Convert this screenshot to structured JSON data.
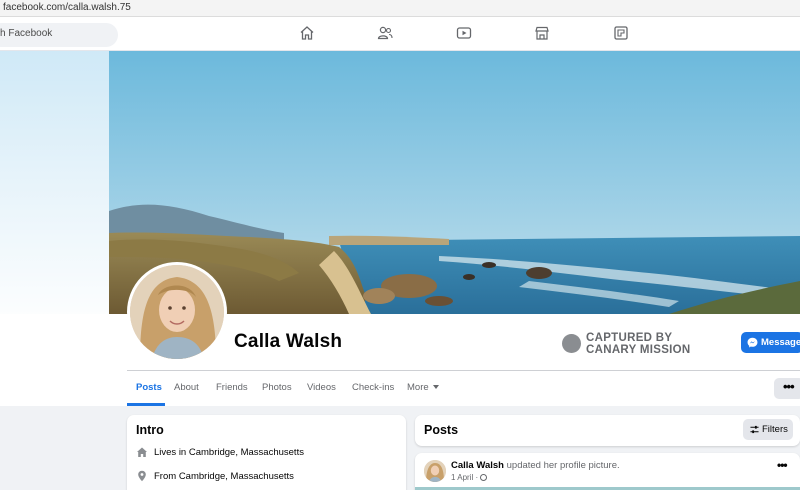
{
  "browser": {
    "url": "facebook.com/calla.walsh.75"
  },
  "topnav": {
    "search_placeholder": "h Facebook",
    "icons": [
      "home-icon",
      "friends-icon",
      "watch-icon",
      "marketplace-icon",
      "gaming-icon"
    ]
  },
  "profile": {
    "name": "Calla Walsh",
    "watermark_line1": "CAPTURED BY",
    "watermark_line2": "CANARY MISSION",
    "message_label": "Message"
  },
  "tabs": [
    {
      "label": "Posts",
      "active": true
    },
    {
      "label": "About"
    },
    {
      "label": "Friends"
    },
    {
      "label": "Photos"
    },
    {
      "label": "Videos"
    },
    {
      "label": "Check-ins"
    },
    {
      "label": "More"
    }
  ],
  "more_dots": "•••",
  "intro": {
    "title": "Intro",
    "lives_prefix": "Lives in ",
    "lives_value": "Cambridge, Massachusetts",
    "from_prefix": "From ",
    "from_value": "Cambridge, Massachusetts"
  },
  "posts": {
    "title": "Posts",
    "filters_label": "Filters",
    "post": {
      "author": "Calla Walsh",
      "action": " updated her profile picture.",
      "date": "1 April ·",
      "more": "•••"
    }
  },
  "colors": {
    "accent": "#1b74e4",
    "text_secondary": "#65676b",
    "background": "#f0f2f5"
  }
}
